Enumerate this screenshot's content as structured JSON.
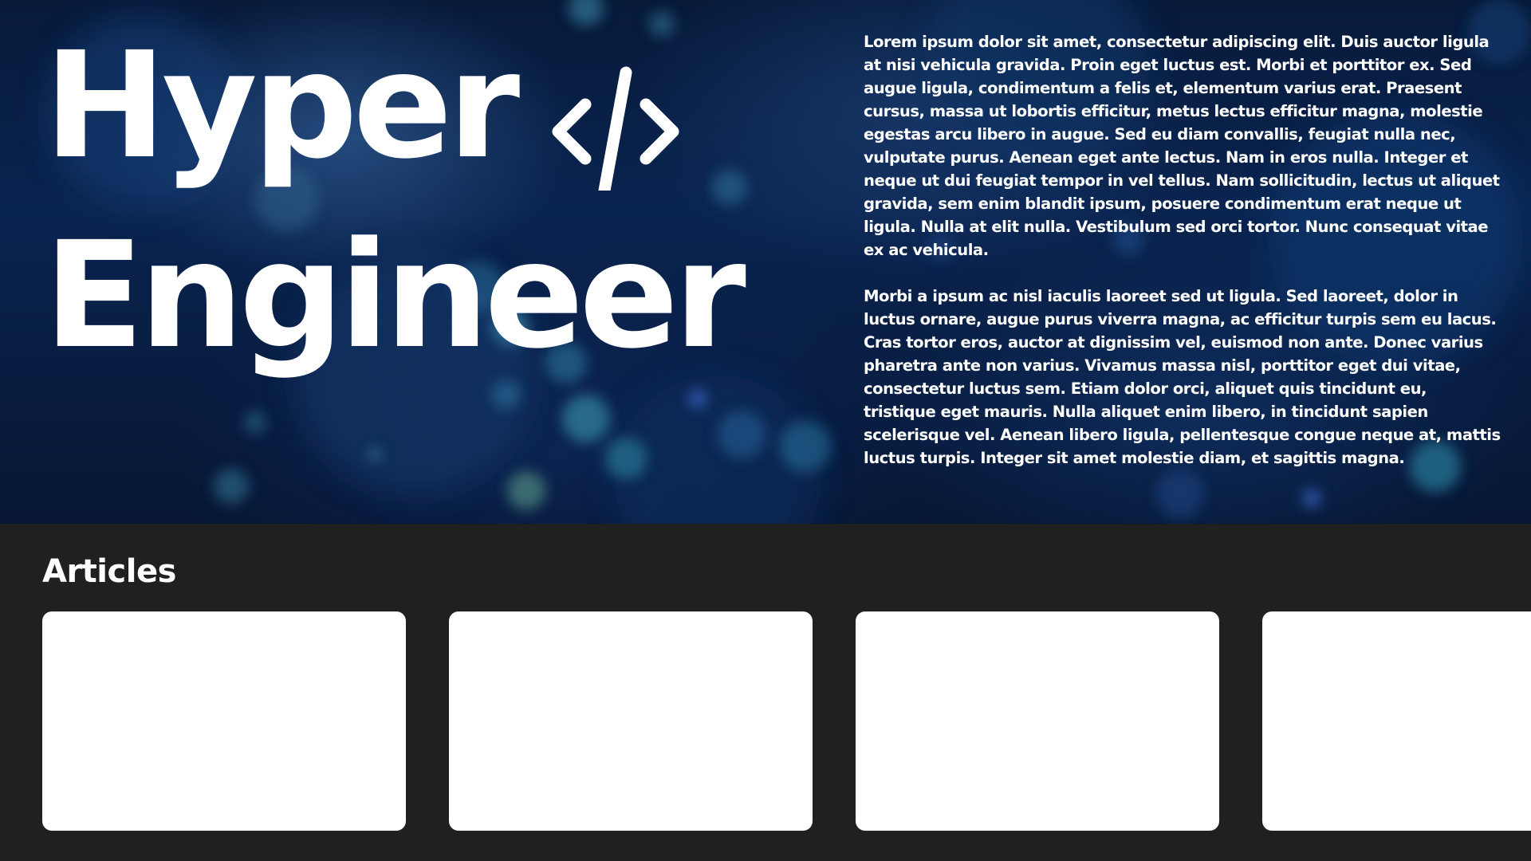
{
  "hero": {
    "title_line1": "Hyper",
    "title_line2": "Engineer",
    "title_icon": "code-icon",
    "paragraphs": [
      "Lorem ipsum dolor sit amet, consectetur adipiscing elit. Duis auctor ligula at nisi vehicula gravida. Proin eget luctus est. Morbi et porttitor ex. Sed augue ligula, condimentum a felis et, elementum varius erat. Praesent cursus, massa ut lobortis efficitur, metus lectus efficitur magna, molestie egestas arcu libero in augue. Sed eu diam convallis, feugiat nulla nec, vulputate purus. Aenean eget ante lectus. Nam in eros nulla. Integer et neque ut dui feugiat tempor in vel tellus. Nam sollicitudin, lectus ut aliquet gravida, sem enim blandit ipsum, posuere condimentum erat neque ut ligula. Nulla at elit nulla. Vestibulum sed orci tortor. Nunc consequat vitae ex ac vehicula.",
      "Morbi a ipsum ac nisl iaculis laoreet sed ut ligula. Sed laoreet, dolor in luctus ornare, augue purus viverra magna, ac efficitur turpis sem eu lacus. Cras tortor eros, auctor at dignissim vel, euismod non ante. Donec varius pharetra ante non varius. Vivamus massa nisl, porttitor eget dui vitae, consectetur luctus sem. Etiam dolor orci, aliquet quis tincidunt eu, tristique eget mauris. Nulla aliquet enim libero, in tincidunt sapien scelerisque vel. Aenean libero ligula, pellentesque congue neque at, mattis luctus turpis. Integer sit amet molestie diam, et sagittis magna."
    ]
  },
  "articles": {
    "heading": "Articles",
    "cards": [
      {
        "title": ""
      },
      {
        "title": ""
      },
      {
        "title": ""
      },
      {
        "title": ""
      }
    ]
  },
  "colors": {
    "hero_background": "#0a2450",
    "articles_background": "#202020",
    "card_background": "#ffffff",
    "text": "#ffffff"
  }
}
